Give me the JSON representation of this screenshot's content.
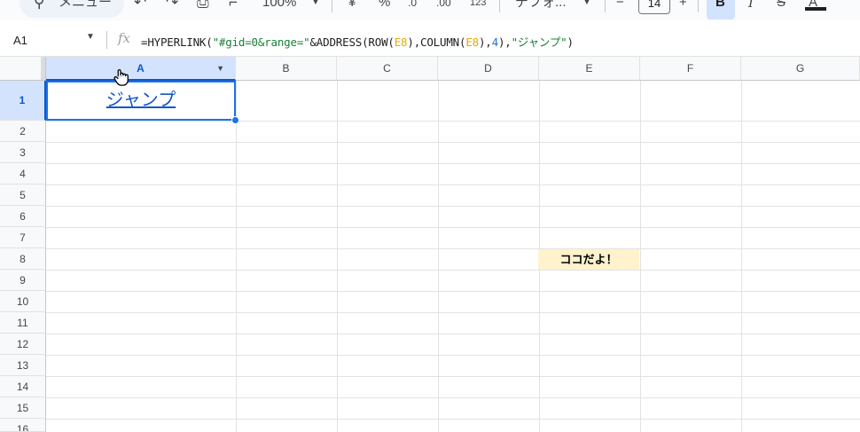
{
  "toolbar": {
    "menu_search_label": "メニュー",
    "undo_icon": "undo-icon",
    "redo_icon": "redo-icon",
    "print_icon": "print-icon",
    "paint_format_icon": "paint-format-icon",
    "zoom": "100%",
    "currency": "¥",
    "percent": "%",
    "decrease_decimal": ".0",
    "increase_decimal": ".00",
    "number_format": "123",
    "font_name": "デフォ...",
    "font_size": "14",
    "minus": "−",
    "plus": "+",
    "bold": "B",
    "italic": "I",
    "strike": "S",
    "text_color": "A"
  },
  "formula_bar": {
    "name_box": "A1",
    "fx": "fx",
    "formula_parts": {
      "p1": "=HYPERLINK(",
      "p2": "\"#gid=0&range=\"",
      "p3": "&ADDRESS(ROW(",
      "p4": "E8",
      "p5": "),COLUMN(",
      "p6": "E8",
      "p7": "),",
      "p8": "4",
      "p9": "),",
      "p10": "\"ジャンプ\"",
      "p11": ")"
    }
  },
  "columns": [
    "A",
    "B",
    "C",
    "D",
    "E",
    "F",
    "G"
  ],
  "rows": [
    "1",
    "2",
    "3",
    "4",
    "5",
    "6",
    "7",
    "8",
    "9",
    "10",
    "11",
    "12",
    "13",
    "14",
    "15",
    "16"
  ],
  "cells": {
    "A1": "ジャンプ",
    "E8": "ココだよ！"
  },
  "colors": {
    "selection": "#1a73e8",
    "link": "#1155cc",
    "highlight_cell": "#fff2cc",
    "header_selected": "#d3e3fd"
  }
}
